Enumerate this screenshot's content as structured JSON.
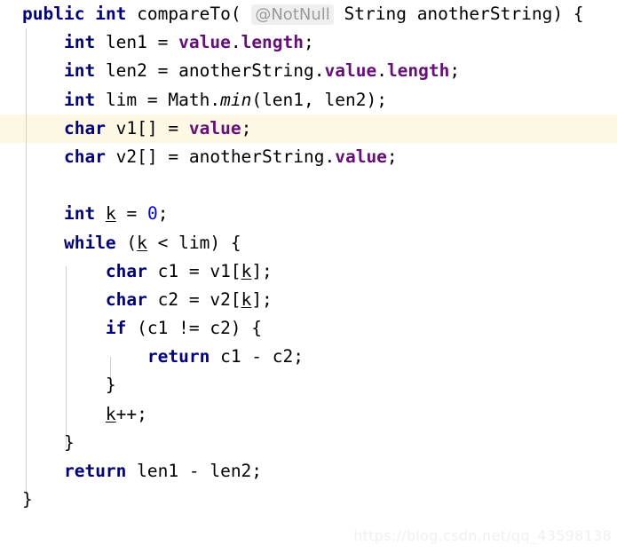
{
  "editor": {
    "language": "Java",
    "theme": "IntelliJ Light",
    "caret_line_index": 4,
    "colors": {
      "background": "#ffffff",
      "keyword": "#000080",
      "field": "#660e7a",
      "number": "#0000ff",
      "default_text": "#000000",
      "caret_row_highlight": "#fdf8e3",
      "inlay_hint_background": "#efefef",
      "inlay_hint_text": "#9a9a9a",
      "indent_guide": "#d0d0d0",
      "watermark": "#f0f0f0"
    },
    "inlay_hint": "@NotNull",
    "lines": [
      {
        "n": 1,
        "indent": 0,
        "text": "public int compareTo( @NotNull String anotherString) {"
      },
      {
        "n": 2,
        "indent": 1,
        "text": "int len1 = value.length;"
      },
      {
        "n": 3,
        "indent": 1,
        "text": "int len2 = anotherString.value.length;"
      },
      {
        "n": 4,
        "indent": 1,
        "text": "int lim = Math.min(len1, len2);"
      },
      {
        "n": 5,
        "indent": 1,
        "text": "char v1[] = value;"
      },
      {
        "n": 6,
        "indent": 1,
        "text": "char v2[] = anotherString.value;"
      },
      {
        "n": 7,
        "indent": 0,
        "text": ""
      },
      {
        "n": 8,
        "indent": 1,
        "text": "int k = 0;"
      },
      {
        "n": 9,
        "indent": 1,
        "text": "while (k < lim) {"
      },
      {
        "n": 10,
        "indent": 2,
        "text": "char c1 = v1[k];"
      },
      {
        "n": 11,
        "indent": 2,
        "text": "char c2 = v2[k];"
      },
      {
        "n": 12,
        "indent": 2,
        "text": "if (c1 != c2) {"
      },
      {
        "n": 13,
        "indent": 3,
        "text": "return c1 - c2;"
      },
      {
        "n": 14,
        "indent": 2,
        "text": "}"
      },
      {
        "n": 15,
        "indent": 2,
        "text": "k++;"
      },
      {
        "n": 16,
        "indent": 1,
        "text": "}"
      },
      {
        "n": 17,
        "indent": 1,
        "text": "return len1 - len2;"
      },
      {
        "n": 18,
        "indent": 0,
        "text": "}"
      }
    ]
  },
  "watermark": {
    "text": "https://blog.csdn.net/qq_43598138"
  }
}
